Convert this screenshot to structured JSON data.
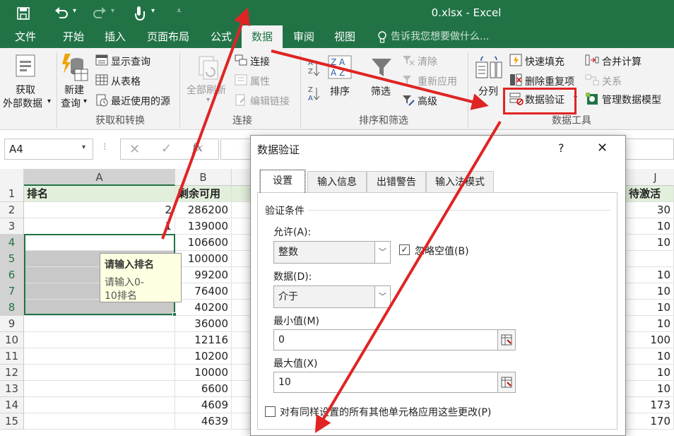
{
  "titlebar": {
    "title": "0.xlsx - Excel",
    "save_icon": "save-icon",
    "undo_icon": "undo-icon",
    "redo_icon": "redo-icon",
    "touch_icon": "touch-mode-icon"
  },
  "tabs": [
    "文件",
    "开始",
    "插入",
    "页面布局",
    "公式",
    "数据",
    "审阅",
    "视图"
  ],
  "tell_me": "告诉我您想要做什么...",
  "ribbon": {
    "get_external_line1": "获取",
    "get_external_line2": "外部数据",
    "new_query_line1": "新建",
    "new_query_line2": "查询",
    "show_queries": "显示查询",
    "from_table": "从表格",
    "recent_sources": "最近使用的源",
    "group_get_transform": "获取和转换",
    "refresh_all": "全部刷新",
    "connections": "连接",
    "properties": "属性",
    "edit_links": "编辑链接",
    "group_connections": "连接",
    "sort": "排序",
    "filter": "筛选",
    "clear": "清除",
    "reapply": "重新应用",
    "advanced": "高级",
    "group_sort_filter": "排序和筛选",
    "text_to_columns": "分列",
    "flash_fill": "快速填充",
    "remove_duplicates": "删除重复项",
    "data_validation": "数据验证",
    "consolidate": "合并计算",
    "relationships": "关系",
    "manage_model": "管理数据模型",
    "group_data_tools": "数据工具"
  },
  "formula_bar": {
    "name_box": "A4"
  },
  "columns": [
    "A",
    "B",
    "J"
  ],
  "rows": [
    {
      "n": "1",
      "a": "排名",
      "b": "剩余可用",
      "j": "待激活"
    },
    {
      "n": "2",
      "a": "2",
      "b": "286200",
      "j": "30"
    },
    {
      "n": "3",
      "a": "1",
      "b": "139000",
      "j": "10"
    },
    {
      "n": "4",
      "a": "",
      "b": "106600",
      "j": "10"
    },
    {
      "n": "5",
      "a": "",
      "b": "100000",
      "j": ""
    },
    {
      "n": "6",
      "a": "",
      "b": "99200",
      "j": "10"
    },
    {
      "n": "7",
      "a": "",
      "b": "76400",
      "j": "10"
    },
    {
      "n": "8",
      "a": "",
      "b": "40200",
      "j": "10"
    },
    {
      "n": "9",
      "a": "",
      "b": "36000",
      "j": "10"
    },
    {
      "n": "10",
      "a": "",
      "b": "12116",
      "j": "100"
    },
    {
      "n": "11",
      "a": "",
      "b": "10200",
      "j": "10"
    },
    {
      "n": "12",
      "a": "",
      "b": "10000",
      "j": "10"
    },
    {
      "n": "13",
      "a": "",
      "b": "6600",
      "j": "10"
    },
    {
      "n": "14",
      "a": "",
      "b": "4609",
      "j": "173"
    },
    {
      "n": "15",
      "a": "",
      "b": "4639",
      "j": "170"
    }
  ],
  "tooltip": {
    "title": "请输入排名",
    "body_line1": "请输入0-",
    "body_line2": "10排名"
  },
  "dialog": {
    "title": "数据验证",
    "help": "?",
    "close": "✕",
    "tabs": [
      "设置",
      "输入信息",
      "出错警告",
      "输入法模式"
    ],
    "section": "验证条件",
    "allow_label": "允许(A):",
    "allow_value": "整数",
    "ignore_blank": "忽略空值(B)",
    "data_label": "数据(D):",
    "data_value": "介于",
    "min_label": "最小值(M)",
    "min_value": "0",
    "max_label": "最大值(X)",
    "max_value": "10",
    "apply_all": "对有同样设置的所有其他单元格应用这些更改(P)"
  },
  "colors": {
    "excel_green": "#217346",
    "arrow_red": "#e02424",
    "tooltip_bg": "#ffffe1",
    "header_row_bg": "#e2efda"
  }
}
